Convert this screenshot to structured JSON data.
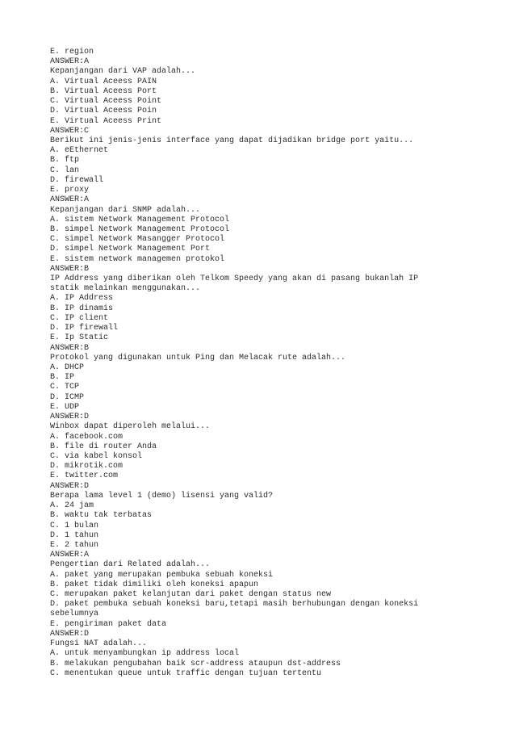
{
  "document": {
    "lines": [
      "E. region",
      "ANSWER:A",
      "Kepanjangan dari VAP adalah...",
      "A. Virtual Aceess PAIN",
      "B. Virtual Aceess Port",
      "C. Virtual Aceess Point",
      "D. Virtual Aceess Poin",
      "E. Virtual Aceess Print",
      "ANSWER:C",
      "Berikut ini jenis-jenis interface yang dapat dijadikan bridge port yaitu...",
      "A. eEthernet",
      "B. ftp",
      "C. lan",
      "D. firewall",
      "E. proxy",
      "ANSWER:A",
      "Kepanjangan dari SNMP adalah...",
      "A. sistem Network Management Protocol",
      "B. simpel Network Management Protocol",
      "C. simpel Network Masangger Protocol",
      "D. simpel Network Management Port",
      "E. sistem network managemen protokol",
      "ANSWER:B",
      "IP Address yang diberikan oleh Telkom Speedy yang akan di pasang bukanlah IP",
      "statik melainkan menggunakan...",
      "A. IP Address",
      "B. IP dinamis",
      "C. IP client",
      "D. IP firewall",
      "E. Ip Static",
      "ANSWER:B",
      "Protokol yang digunakan untuk Ping dan Melacak rute adalah...",
      "A. DHCP",
      "B. IP",
      "C. TCP",
      "D. ICMP",
      "E. UDP",
      "ANSWER:D",
      "Winbox dapat diperoleh melalui...",
      "A. facebook.com",
      "B. file di router Anda",
      "C. via kabel konsol",
      "D. mikrotik.com",
      "E. twitter.com",
      "ANSWER:D",
      "Berapa lama level 1 (demo) lisensi yang valid?",
      "A. 24 jam",
      "B. waktu tak terbatas",
      "C. 1 bulan",
      "D. 1 tahun",
      "E. 2 tahun",
      "ANSWER:A",
      "Pengertian dari Related adalah...",
      "A. paket yang merupakan pembuka sebuah koneksi",
      "B. paket tidak dimiliki oleh koneksi apapun",
      "C. merupakan paket kelanjutan dari paket dengan status new",
      "D. paket pembuka sebuah koneksi baru,tetapi masih berhubungan dengan koneksi",
      "sebelumnya",
      "E. pengiriman paket data",
      "ANSWER:D",
      "Fungsi NAT adalah...",
      "A. untuk menyambungkan ip address local",
      "B. melakukan pengubahan baik scr-address ataupun dst-address",
      "C. menentukan queue untuk traffic dengan tujuan tertentu"
    ]
  }
}
